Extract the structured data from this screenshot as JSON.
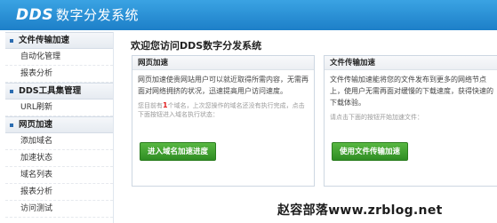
{
  "header": {
    "logo_text": "DDS",
    "logo_sub": "数字分发系统"
  },
  "sidebar": {
    "sections": [
      {
        "title": "文件传输加速",
        "items": [
          "自动化管理",
          "报表分析"
        ]
      },
      {
        "title": "DDS工具集管理",
        "items": [
          "URL刷新"
        ]
      },
      {
        "title": "网页加速",
        "items": [
          "添加域名",
          "加速状态",
          "域名列表",
          "报表分析",
          "访问测试"
        ]
      }
    ]
  },
  "main": {
    "title": "欢迎您访问DDS数字分发系统",
    "web_panel": {
      "title": "网页加速",
      "text": "网页加速使贵网站用户可以就近取得所需内容，无需再面对网络拥挤的状况，迅速提高用户访问速度。",
      "note_prefix": "您目前有",
      "note_count": "1",
      "note_suffix": "个域名，上次您操作的域名还没有执行完成，点击下面按钮进入域名执行状态：",
      "button_label": "进入域名加速进度"
    },
    "file_panel": {
      "title": "文件传输加速",
      "text": "文件传输加速能将您的文件发布到更多的网络节点上，使用户无需再面对缓慢的下载速度，获得快速的下载体验。",
      "note": "请点击下面的按钮开始加速文件：",
      "button_label": "使用文件传输加速"
    }
  },
  "watermark": "赵容部落www.zrblog.net"
}
